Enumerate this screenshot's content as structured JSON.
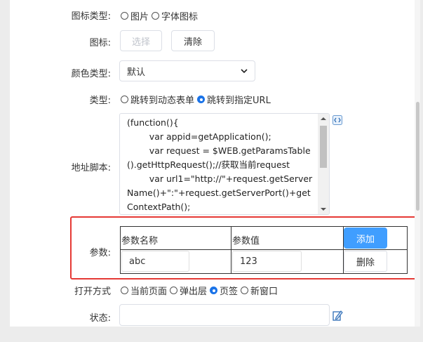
{
  "form": {
    "icon_type": {
      "label": "图标类型:",
      "options": [
        "图片",
        "字体图标"
      ]
    },
    "icon": {
      "label": "图标:",
      "select_button": "选择",
      "clear_button": "清除"
    },
    "color_type": {
      "label": "颜色类型:",
      "value": "默认"
    },
    "type": {
      "label": "类型:",
      "options": [
        "跳转到动态表单",
        "跳转到指定URL"
      ],
      "selected": 1
    },
    "address_script": {
      "label": "地址脚本:",
      "value": "(function(){\n\tvar appid=getApplication();\n\tvar request = $WEB.getParamsTable().getHttpRequest();//获取当前request\n\tvar url1=\"http://\"+request.getServerName()+\":\"+request.getServerPort()+getContextPath();"
    },
    "params": {
      "label": "参数:",
      "headers": [
        "参数名称",
        "参数值"
      ],
      "add_button": "添加",
      "rows": [
        {
          "name": "abc",
          "value": "123",
          "delete_button": "删除"
        }
      ]
    },
    "open_mode": {
      "label": "打开方式",
      "options": [
        "当前页面",
        "弹出层",
        "页签",
        "新窗口"
      ],
      "selected": 2
    },
    "status": {
      "label": "状态:"
    }
  },
  "colors": {
    "accent": "#409eff",
    "highlight": "#e53935"
  }
}
